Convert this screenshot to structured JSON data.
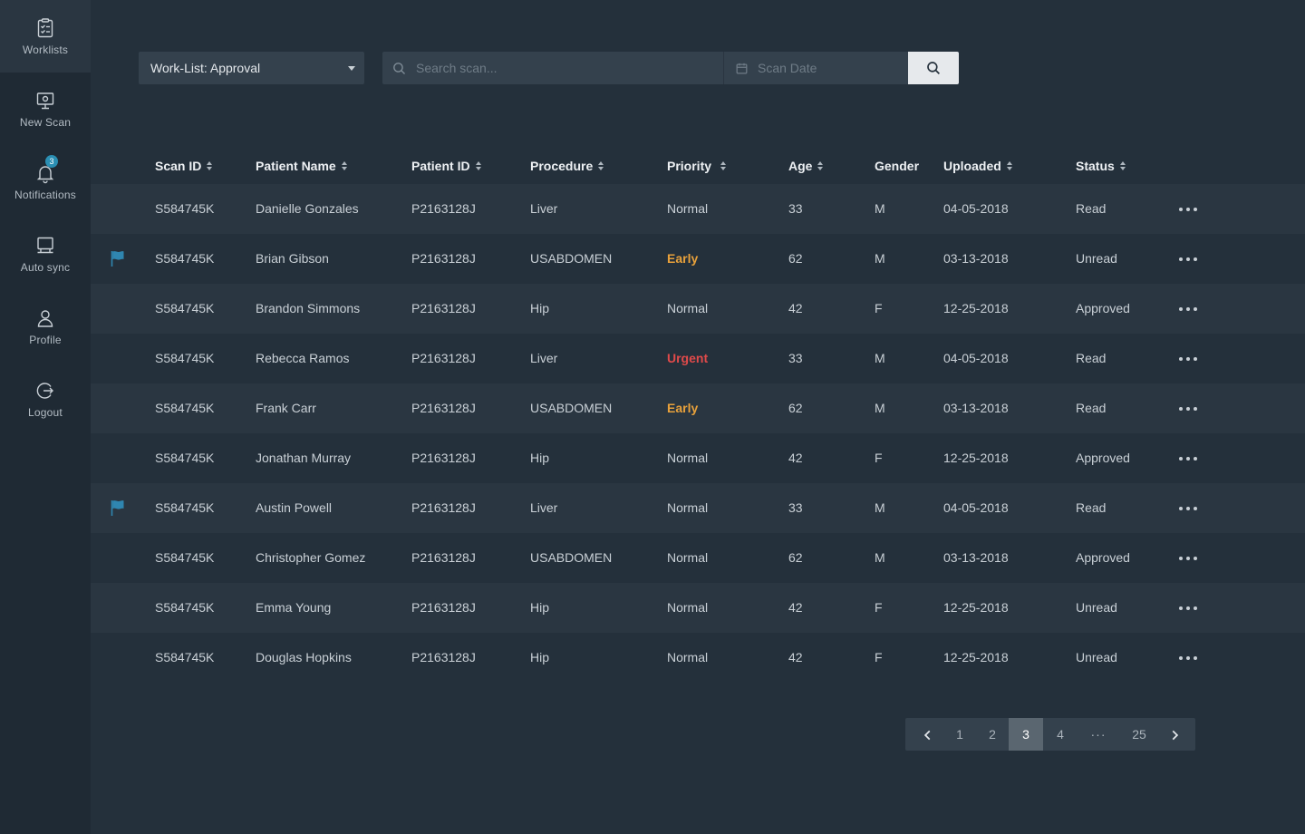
{
  "sidebar": {
    "items": [
      {
        "label": "Worklists",
        "icon": "clipboard-check-icon",
        "active": true
      },
      {
        "label": "New Scan",
        "icon": "monitor-icon"
      },
      {
        "label": "Notifications",
        "icon": "bell-icon",
        "badge": "3"
      },
      {
        "label": "Auto sync",
        "icon": "sync-monitor-icon"
      },
      {
        "label": "Profile",
        "icon": "user-icon"
      },
      {
        "label": "Logout",
        "icon": "logout-icon"
      }
    ]
  },
  "toolbar": {
    "worklist_value": "Work-List: Approval",
    "search_placeholder": "Search scan...",
    "date_placeholder": "Scan Date"
  },
  "table": {
    "columns": [
      "Scan ID",
      "Patient Name",
      "Patient ID",
      "Procedure",
      "Priority",
      "Age",
      "Gender",
      "Uploaded",
      "Status"
    ],
    "rows": [
      {
        "flag": false,
        "scan_id": "S584745K",
        "name": "Danielle Gonzales",
        "patient_id": "P2163128J",
        "procedure": "Liver",
        "priority": "Normal",
        "age": "33",
        "gender": "M",
        "uploaded": "04-05-2018",
        "status": "Read"
      },
      {
        "flag": true,
        "scan_id": "S584745K",
        "name": "Brian Gibson",
        "patient_id": "P2163128J",
        "procedure": "USABDOMEN",
        "priority": "Early",
        "age": "62",
        "gender": "M",
        "uploaded": "03-13-2018",
        "status": "Unread"
      },
      {
        "flag": false,
        "scan_id": "S584745K",
        "name": "Brandon Simmons",
        "patient_id": "P2163128J",
        "procedure": "Hip",
        "priority": "Normal",
        "age": "42",
        "gender": "F",
        "uploaded": "12-25-2018",
        "status": "Approved"
      },
      {
        "flag": false,
        "scan_id": "S584745K",
        "name": "Rebecca Ramos",
        "patient_id": "P2163128J",
        "procedure": "Liver",
        "priority": "Urgent",
        "age": "33",
        "gender": "M",
        "uploaded": "04-05-2018",
        "status": "Read"
      },
      {
        "flag": false,
        "scan_id": "S584745K",
        "name": "Frank Carr",
        "patient_id": "P2163128J",
        "procedure": "USABDOMEN",
        "priority": "Early",
        "age": "62",
        "gender": "M",
        "uploaded": "03-13-2018",
        "status": "Read"
      },
      {
        "flag": false,
        "scan_id": "S584745K",
        "name": "Jonathan Murray",
        "patient_id": "P2163128J",
        "procedure": "Hip",
        "priority": "Normal",
        "age": "42",
        "gender": "F",
        "uploaded": "12-25-2018",
        "status": "Approved"
      },
      {
        "flag": true,
        "scan_id": "S584745K",
        "name": "Austin Powell",
        "patient_id": "P2163128J",
        "procedure": "Liver",
        "priority": "Normal",
        "age": "33",
        "gender": "M",
        "uploaded": "04-05-2018",
        "status": "Read"
      },
      {
        "flag": false,
        "scan_id": "S584745K",
        "name": "Christopher Gomez",
        "patient_id": "P2163128J",
        "procedure": "USABDOMEN",
        "priority": "Normal",
        "age": "62",
        "gender": "M",
        "uploaded": "03-13-2018",
        "status": "Approved"
      },
      {
        "flag": false,
        "scan_id": "S584745K",
        "name": "Emma Young",
        "patient_id": "P2163128J",
        "procedure": "Hip",
        "priority": "Normal",
        "age": "42",
        "gender": "F",
        "uploaded": "12-25-2018",
        "status": "Unread"
      },
      {
        "flag": false,
        "scan_id": "S584745K",
        "name": "Douglas Hopkins",
        "patient_id": "P2163128J",
        "procedure": "Hip",
        "priority": "Normal",
        "age": "42",
        "gender": "F",
        "uploaded": "12-25-2018",
        "status": "Unread"
      }
    ]
  },
  "pagination": {
    "pages": [
      "1",
      "2",
      "3",
      "4",
      "···",
      "25"
    ],
    "current": "3"
  },
  "colors": {
    "background": "#24303b",
    "sidebar": "#1f2a34",
    "flag": "#2f86b0",
    "priority_early": "#e8a13b",
    "priority_urgent": "#e04a4a",
    "badge": "#2b8fb3"
  }
}
